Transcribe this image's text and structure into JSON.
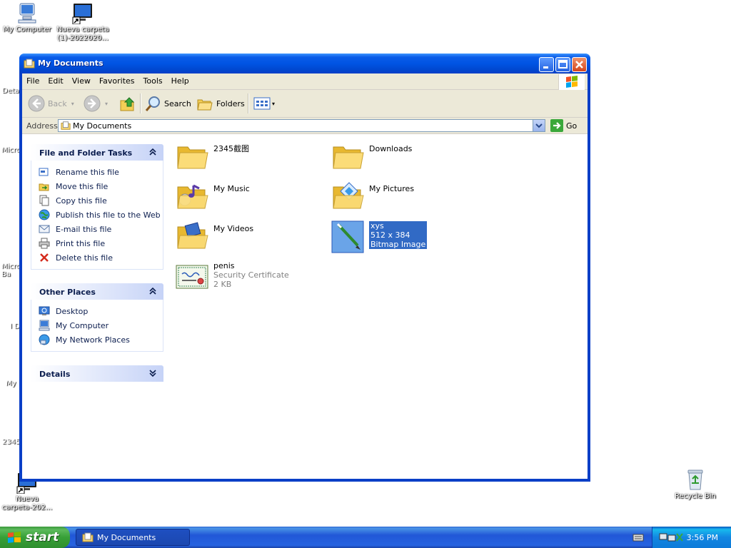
{
  "desktop": {
    "icons": [
      {
        "label": "My Computer"
      },
      {
        "label": "Nueva carpeta (1)-2022020..."
      },
      {
        "label": "Nueva carpeta-202..."
      },
      {
        "label": "Recycle Bin"
      }
    ],
    "partial_labels": [
      "Deta",
      "Micro",
      "Micro Ba",
      "I D",
      "My",
      "2345"
    ]
  },
  "window": {
    "title": "My Documents",
    "menu": [
      "File",
      "Edit",
      "View",
      "Favorites",
      "Tools",
      "Help"
    ],
    "toolbar": {
      "back": "Back",
      "search": "Search",
      "folders": "Folders"
    },
    "address": {
      "label": "Address",
      "value": "My Documents",
      "go": "Go"
    }
  },
  "taskpane": {
    "file_tasks": {
      "title": "File and Folder Tasks",
      "items": [
        {
          "label": "Rename this file",
          "icon": "rename-icon"
        },
        {
          "label": "Move this file",
          "icon": "move-icon"
        },
        {
          "label": "Copy this file",
          "icon": "copy-icon"
        },
        {
          "label": "Publish this file to the Web",
          "icon": "globe-icon"
        },
        {
          "label": "E-mail this file",
          "icon": "email-icon"
        },
        {
          "label": "Print this file",
          "icon": "printer-icon"
        },
        {
          "label": "Delete this file",
          "icon": "delete-icon"
        }
      ]
    },
    "other_places": {
      "title": "Other Places",
      "items": [
        {
          "label": "Desktop",
          "icon": "desktop-icon"
        },
        {
          "label": "My Computer",
          "icon": "computer-icon"
        },
        {
          "label": "My Network Places",
          "icon": "network-icon"
        }
      ]
    },
    "details": {
      "title": "Details"
    }
  },
  "files": [
    {
      "name": "2345截图",
      "type": "folder"
    },
    {
      "name": "Downloads",
      "type": "folder"
    },
    {
      "name": "My Music",
      "type": "music-folder"
    },
    {
      "name": "My Pictures",
      "type": "pictures-folder"
    },
    {
      "name": "My Videos",
      "type": "videos-folder"
    },
    {
      "name": "xys",
      "line2": "512 x 384",
      "line3": "Bitmap Image",
      "type": "bitmap",
      "selected": true
    },
    {
      "name": "penis",
      "line2": "Security Certificate",
      "line3": "2 KB",
      "type": "certificate"
    }
  ],
  "taskbar": {
    "start": "start",
    "task": "My Documents",
    "clock": "3:56 PM"
  },
  "colors": {
    "title_blue": "#0054e3",
    "taskbar_blue": "#2157d7",
    "start_green": "#37a037",
    "selection": "#316ac5"
  }
}
